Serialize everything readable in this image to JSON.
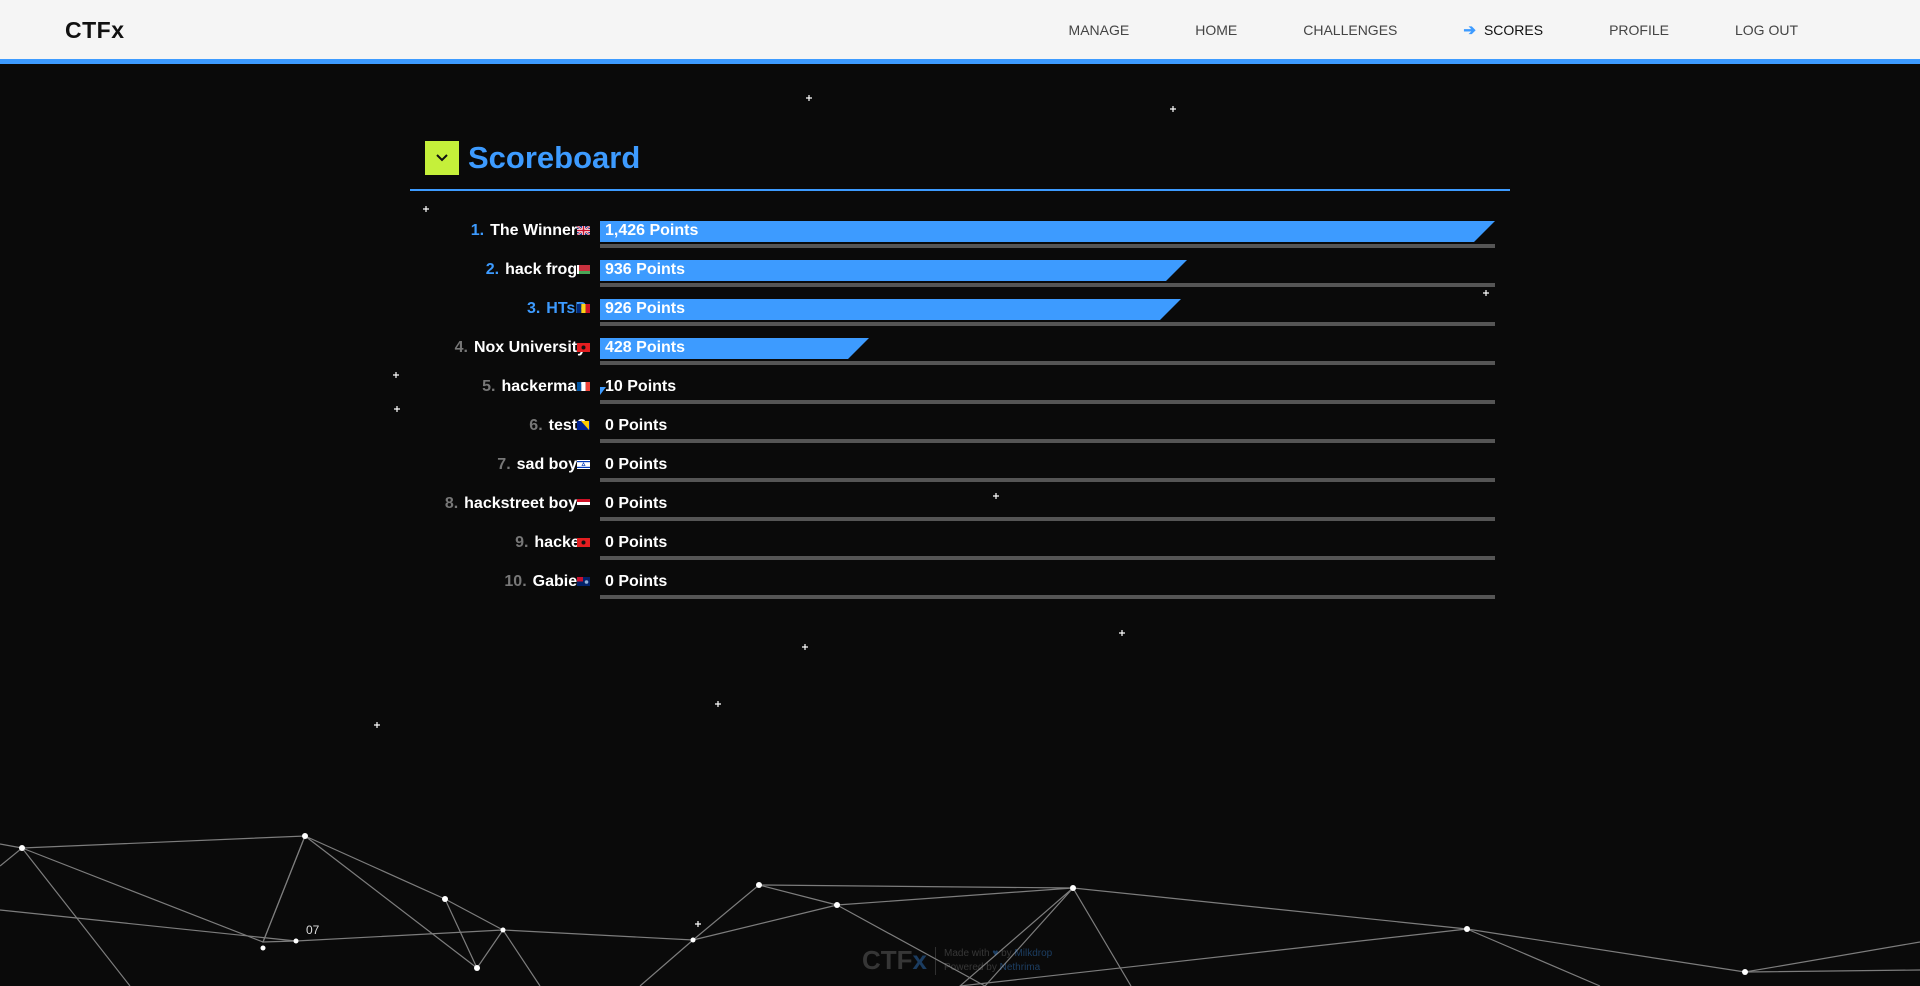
{
  "app": {
    "logo": "CTFx"
  },
  "nav": {
    "items": [
      {
        "label": "MANAGE"
      },
      {
        "label": "HOME"
      },
      {
        "label": "CHALLENGES"
      },
      {
        "label": "SCORES",
        "active": true
      },
      {
        "label": "PROFILE"
      },
      {
        "label": "LOG OUT"
      }
    ],
    "active_icon": "arrow-right-icon"
  },
  "section": {
    "title": "Scoreboard",
    "toggle_icon": "chevron-down-icon"
  },
  "scoreboard": {
    "max_points": 1426,
    "rows": [
      {
        "rank": "1.",
        "team": "The Winners",
        "flag": "gb",
        "points": 1426,
        "points_label": "1,426 Points"
      },
      {
        "rank": "2.",
        "team": "hack frogs",
        "flag": "by",
        "points": 936,
        "points_label": "936 Points"
      },
      {
        "rank": "3.",
        "team": "HTsP",
        "flag": "ro",
        "points": 926,
        "points_label": "926 Points"
      },
      {
        "rank": "4.",
        "team": "Nox University",
        "flag": "al",
        "points": 428,
        "points_label": "428 Points"
      },
      {
        "rank": "5.",
        "team": "hackerman",
        "flag": "fr",
        "points": 10,
        "points_label": "10 Points"
      },
      {
        "rank": "6.",
        "team": "test2",
        "flag": "ba",
        "points": 0,
        "points_label": "0 Points"
      },
      {
        "rank": "7.",
        "team": "sad boys",
        "flag": "il",
        "points": 0,
        "points_label": "0 Points"
      },
      {
        "rank": "8.",
        "team": "hackstreet boys",
        "flag": "ye",
        "points": 0,
        "points_label": "0 Points"
      },
      {
        "rank": "9.",
        "team": "hacker",
        "flag": "al",
        "points": 0,
        "points_label": "0 Points"
      },
      {
        "rank": "10.",
        "team": "Gabies",
        "flag": "fk",
        "points": 0,
        "points_label": "0 Points"
      }
    ]
  },
  "footer": {
    "logo_prefix": "CTF",
    "logo_suffix": "x",
    "made_with": "Made with",
    "by_text": "by",
    "author": "Milkdrop",
    "powered_by": "Powered by",
    "powered_name": "Nethrima",
    "heart_icon": "heart-icon"
  },
  "overlay": {
    "page_number": "07"
  },
  "colors": {
    "accent": "#3d9bff",
    "toggle": "#c5f03a",
    "background": "#0a0a0a",
    "topbar": "#f5f5f5"
  }
}
